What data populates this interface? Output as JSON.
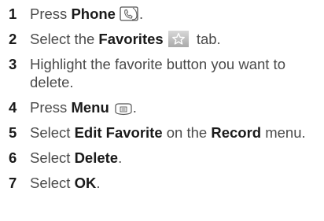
{
  "steps": [
    {
      "num": "1",
      "pre": "Press ",
      "bold": "Phone",
      "post": "."
    },
    {
      "num": "2",
      "pre": "Select the ",
      "bold": "Favorites",
      "post": " tab."
    },
    {
      "num": "3",
      "text": "Highlight the favorite button you want to delete."
    },
    {
      "num": "4",
      "pre": "Press ",
      "bold": "Menu",
      "post": "."
    },
    {
      "num": "5",
      "pre": "Select ",
      "bold": "Edit Favorite",
      "mid": " on the ",
      "bold2": "Record",
      "post": " menu."
    },
    {
      "num": "6",
      "pre": "Select ",
      "bold": "Delete",
      "post": "."
    },
    {
      "num": "7",
      "pre": "Select ",
      "bold": "OK",
      "post": "."
    }
  ],
  "icons": {
    "step1": "phone-key-icon",
    "step2": "favorites-star-icon",
    "step4": "menu-key-icon"
  }
}
